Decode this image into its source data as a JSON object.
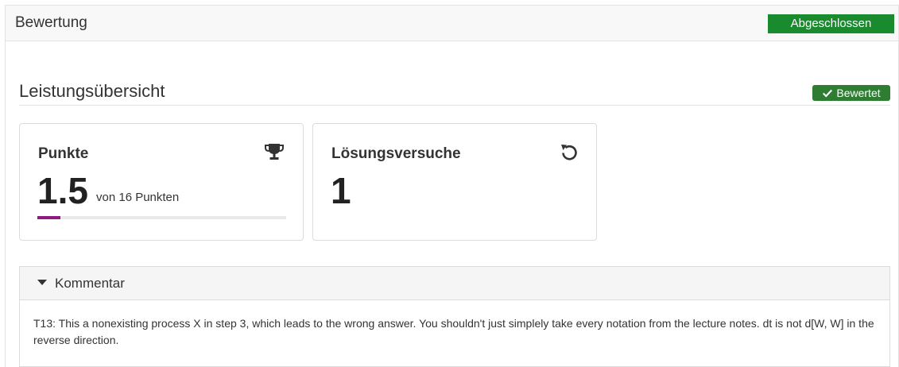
{
  "header": {
    "title": "Bewertung",
    "status_button": "Abgeschlossen"
  },
  "overview": {
    "title": "Leistungsübersicht",
    "badge": "Bewertet"
  },
  "points_card": {
    "title": "Punkte",
    "icon": "trophy-icon",
    "value": "1.5",
    "subtext": "von 16 Punkten",
    "progress_fraction": 0.09375,
    "progress_color": "#8e1b82"
  },
  "attempts_card": {
    "title": "Lösungsversuche",
    "icon": "undo-icon",
    "value": "1"
  },
  "comment": {
    "label": "Kommentar",
    "text": "T13: This a nonexisting process X in step 3, which leads to the wrong answer. You shouldn't just simplely take every notation from the lecture notes. dt is not d[W, W] in the reverse direction."
  },
  "colors": {
    "status_button": "#1a8a2e",
    "badge": "#2e7d32",
    "progress": "#8e1b82"
  }
}
